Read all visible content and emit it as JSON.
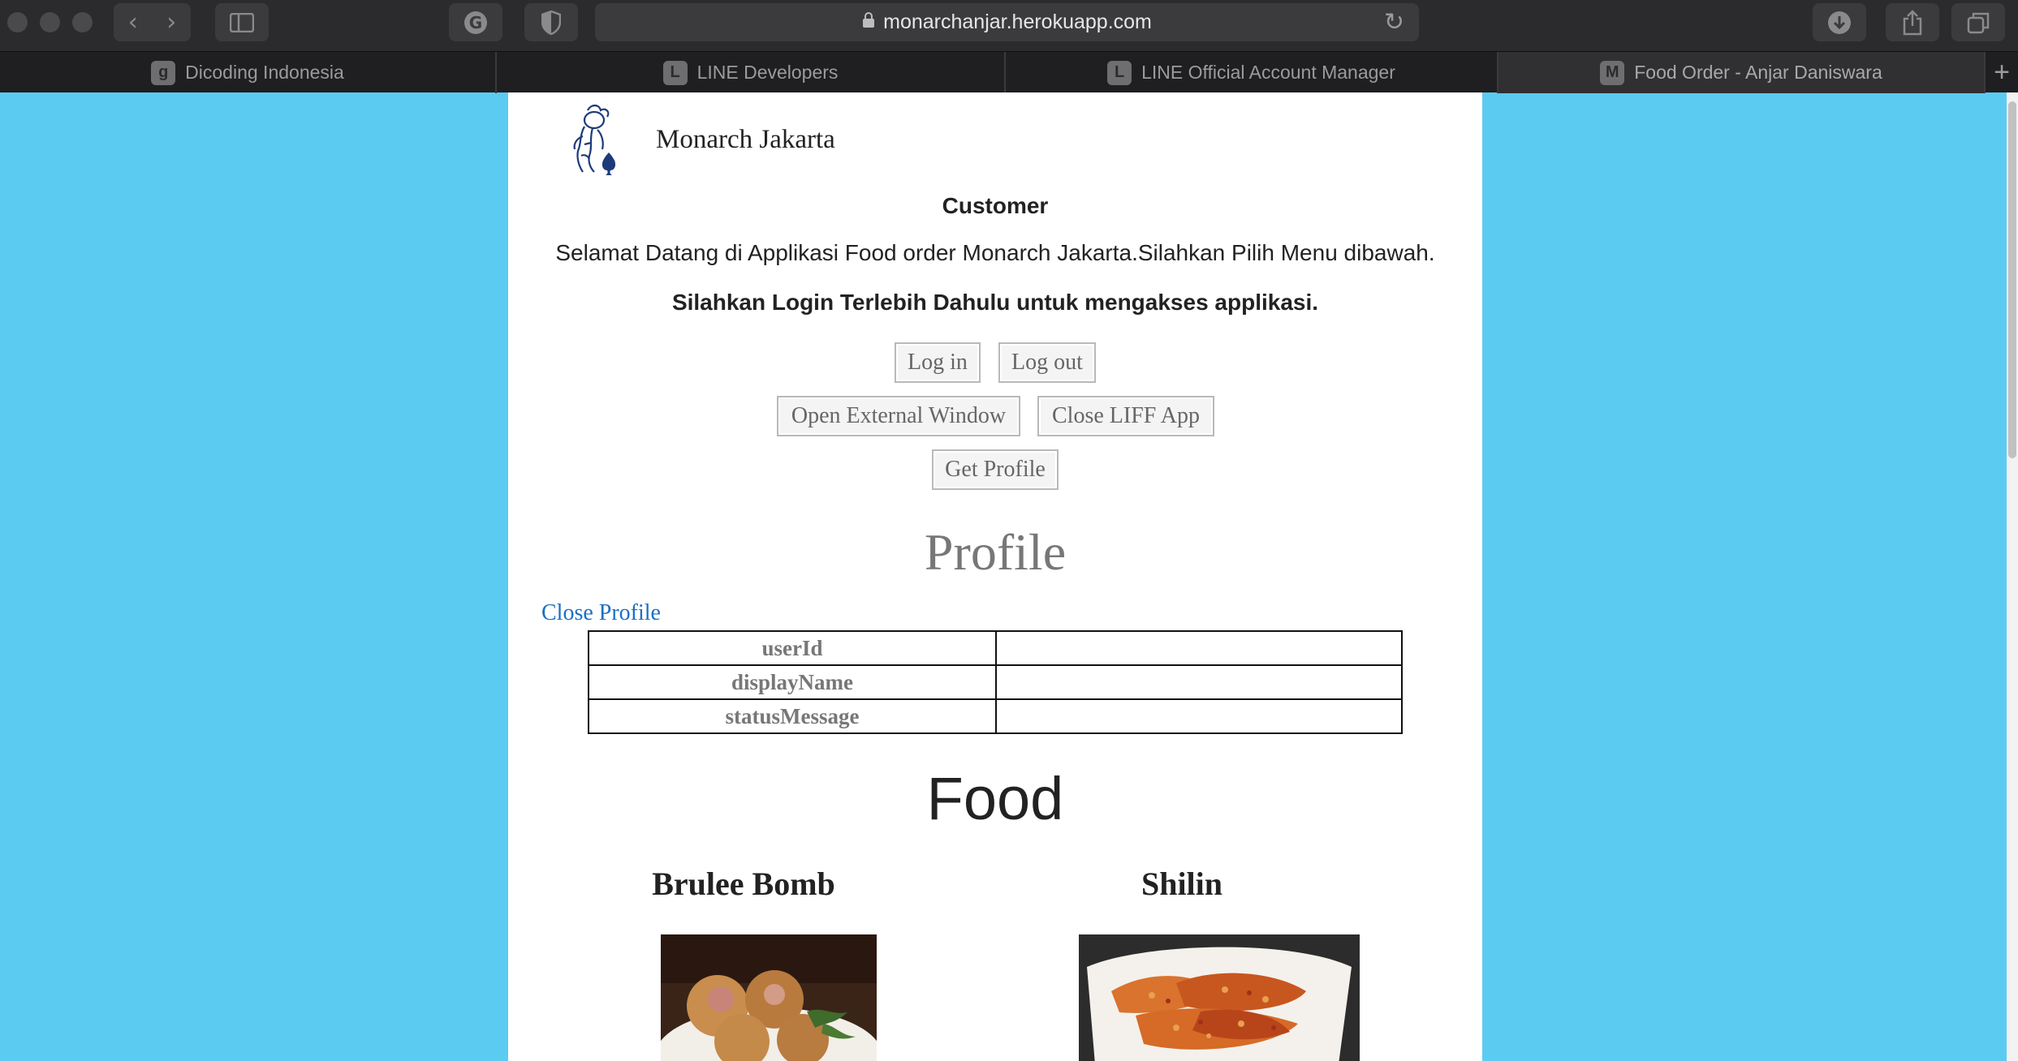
{
  "browser": {
    "url": "monarchanjar.herokuapp.com",
    "tabs": [
      {
        "favicon": "g",
        "label": "Dicoding Indonesia"
      },
      {
        "favicon": "L",
        "label": "LINE Developers"
      },
      {
        "favicon": "L",
        "label": "LINE Official Account Manager"
      },
      {
        "favicon": "M",
        "label": "Food Order - Anjar Daniswara"
      }
    ],
    "icons": {
      "back": "chevron-left-icon",
      "forward": "chevron-right-icon",
      "sidebar": "sidebar-icon",
      "grammarly": "grammarly-icon",
      "privacy": "shield-icon",
      "lock": "lock-icon",
      "reload": "reload-icon",
      "download": "download-icon",
      "share": "share-icon",
      "tabs": "tabs-overview-icon",
      "new_tab": "plus-icon"
    }
  },
  "page": {
    "background_color": "#5ccbf1",
    "brand_name": "Monarch Jakarta",
    "heading": "Customer",
    "welcome": "Selamat Datang di Applikasi Food order Monarch Jakarta.Silahkan Pilih Menu dibawah.",
    "login_note": "Silahkan Login Terlebih Dahulu untuk mengakses applikasi.",
    "buttons": {
      "login": "Log in",
      "logout": "Log out",
      "open_external": "Open External Window",
      "close_liff": "Close LIFF App",
      "get_profile": "Get Profile"
    },
    "profile": {
      "title": "Profile",
      "close_link": "Close Profile",
      "rows": [
        {
          "key": "userId",
          "value": ""
        },
        {
          "key": "displayName",
          "value": ""
        },
        {
          "key": "statusMessage",
          "value": ""
        }
      ]
    },
    "food": {
      "title": "Food",
      "items": [
        {
          "name": "Brulee Bomb"
        },
        {
          "name": "Shilin"
        }
      ]
    }
  }
}
